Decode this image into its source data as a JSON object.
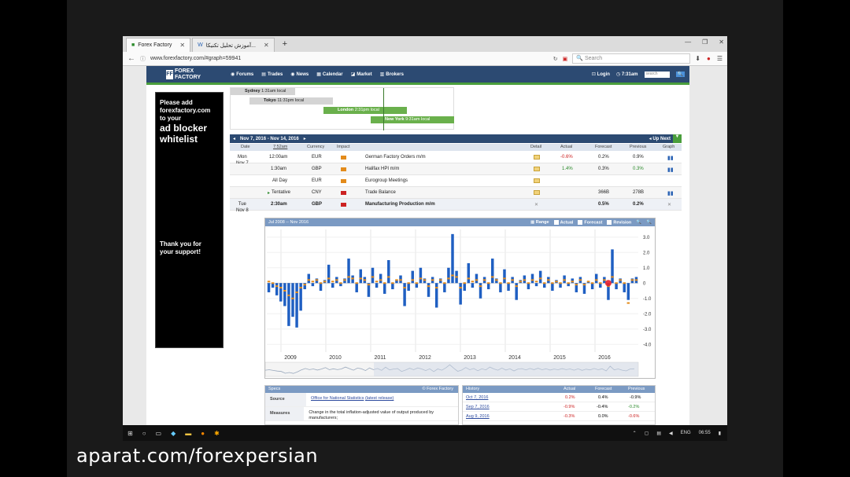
{
  "browser": {
    "tabs": [
      {
        "label": "Forex Factory",
        "active": true
      },
      {
        "label": "آموزش تحلیل تکنیکا...",
        "active": false
      }
    ],
    "url": "www.forexfactory.com/#graph=59941",
    "search_placeholder": "Search"
  },
  "site": {
    "logo_line1": "FOREX",
    "logo_line2": "FACTORY",
    "menu": [
      "Forums",
      "Trades",
      "News",
      "Calendar",
      "Market",
      "Brokers"
    ],
    "login": "Login",
    "time": "7:31am",
    "search_placeholder": "search"
  },
  "ad": {
    "line1": "Please add",
    "line2": "forexfactory.com",
    "line3": "to your",
    "big1": "ad blocker",
    "big2": "whitelist",
    "thanks1": "Thank you for",
    "thanks2": "your support!"
  },
  "sessions": [
    {
      "city": "Sydney",
      "time": "1:31am local"
    },
    {
      "city": "Tokyo",
      "time": "11:31pm local"
    },
    {
      "city": "London",
      "time": "2:31pm local"
    },
    {
      "city": "New York",
      "time": "9:31am local"
    }
  ],
  "calendar": {
    "range": "Nov 7, 2016 - Nov 14, 2016",
    "up_next": "Up Next",
    "columns": {
      "date": "Date",
      "time": "7:52am",
      "currency": "Currency",
      "impact": "Impact",
      "detail": "Detail",
      "actual": "Actual",
      "forecast": "Forecast",
      "previous": "Previous",
      "graph": "Graph"
    },
    "day1": {
      "dow": "Mon",
      "date": "Nov 7"
    },
    "day2": {
      "dow": "Tue",
      "date": "Nov 8"
    },
    "events": [
      {
        "time": "12:00am",
        "currency": "EUR",
        "event": "German Factory Orders m/m",
        "actual": "-0.6%",
        "forecast": "0.2%",
        "previous": "0.9%"
      },
      {
        "time": "1:30am",
        "currency": "GBP",
        "event": "Halifax HPI m/m",
        "actual": "1.4%",
        "forecast": "0.3%",
        "previous": "0.3%"
      },
      {
        "time": "All Day",
        "currency": "EUR",
        "event": "Eurogroup Meetings",
        "actual": "",
        "forecast": "",
        "previous": ""
      },
      {
        "time": "Tentative",
        "currency": "CNY",
        "event": "Trade Balance",
        "actual": "",
        "forecast": "366B",
        "previous": "278B"
      },
      {
        "time": "2:30am",
        "currency": "GBP",
        "event": "Manufacturing Production m/m",
        "actual": "",
        "forecast": "0.5%",
        "previous": "0.2%"
      }
    ]
  },
  "graph": {
    "range_label": "Jul 2008 -- Nov 2016",
    "range_btn": "Range",
    "actual": "Actual",
    "forecast": "Forecast",
    "revision": "Revision"
  },
  "chart_data": {
    "type": "bar",
    "ylim": [
      -4.5,
      3.5
    ],
    "yticks": [
      "3.0",
      "2.0",
      "1.0",
      "0",
      "-1.0",
      "-2.0",
      "-3.0",
      "-4.0"
    ],
    "xticks": [
      "2009",
      "2010",
      "2011",
      "2012",
      "2013",
      "2014",
      "2015",
      "2016"
    ],
    "series": [
      {
        "name": "Actual",
        "values": [
          -0.6,
          -0.3,
          -0.8,
          -1.2,
          -1.5,
          -2.8,
          -2.2,
          -2.9,
          -1.8,
          -0.4,
          0.6,
          -0.2,
          0.3,
          -0.5,
          0.2,
          1.2,
          -0.3,
          0.4,
          -0.2,
          0.3,
          1.6,
          0.5,
          -0.6,
          0.9,
          0.4,
          -0.9,
          1.0,
          -0.3,
          0.6,
          -0.7,
          1.5,
          -0.4,
          0.2,
          0.5,
          -1.5,
          -0.5,
          0.8,
          -0.3,
          1.0,
          0.3,
          -0.9,
          0.4,
          -1.6,
          0.3,
          -0.6,
          1.0,
          3.2,
          0.8,
          -1.4,
          -0.5,
          1.3,
          -0.3,
          0.6,
          -1.0,
          0.4,
          -0.4,
          1.6,
          0.3,
          -0.6,
          0.9,
          -0.5,
          0.4,
          -1.1,
          0.2,
          0.5,
          -0.4,
          0.6,
          -0.2,
          0.8,
          -0.3,
          0.4,
          -0.5,
          0.2,
          -0.3,
          0.5,
          -0.2,
          0.3,
          -0.6,
          0.4,
          -0.7,
          0.1,
          -0.4,
          0.6,
          -0.3,
          0.4,
          -1.1,
          2.2,
          -0.4,
          0.3,
          -0.6,
          -1.1,
          0.3,
          0.4
        ]
      },
      {
        "name": "Forecast",
        "values": [
          0.1,
          0.0,
          -0.2,
          -0.3,
          -0.5,
          -0.8,
          -1.0,
          -0.6,
          -0.3,
          -0.1,
          0.2,
          0.1,
          0.2,
          0.0,
          0.1,
          0.3,
          0.1,
          0.2,
          0.0,
          0.2,
          0.4,
          0.3,
          0.0,
          0.3,
          0.2,
          -0.1,
          0.4,
          0.1,
          0.2,
          0.0,
          0.4,
          0.0,
          0.2,
          0.2,
          -0.3,
          0.0,
          0.2,
          0.0,
          0.3,
          0.2,
          -0.2,
          0.2,
          -0.3,
          0.2,
          0.0,
          0.3,
          0.5,
          0.4,
          -0.3,
          0.0,
          0.3,
          0.1,
          0.2,
          -0.2,
          0.2,
          0.0,
          0.4,
          0.2,
          0.0,
          0.3,
          0.0,
          0.2,
          -0.2,
          0.1,
          0.2,
          0.0,
          0.2,
          0.1,
          0.3,
          0.0,
          0.2,
          0.0,
          0.1,
          0.0,
          0.2,
          0.0,
          0.1,
          -0.1,
          0.2,
          -0.1,
          0.1,
          0.0,
          0.2,
          0.0,
          0.2,
          -0.2,
          0.4,
          0.0,
          0.2,
          0.0,
          -1.3,
          0.2,
          0.2
        ]
      }
    ]
  },
  "specs": {
    "title": "Specs",
    "source_label": "© Forex Factory",
    "source_key": "Source",
    "source_val": "Office for National Statistics",
    "source_link": "(latest release)",
    "measures_key": "Measures",
    "measures_val": "Change in the total inflation-adjusted value of output produced by manufacturers;"
  },
  "history": {
    "title": "History",
    "cols": [
      "Actual",
      "Forecast",
      "Previous"
    ],
    "rows": [
      {
        "date": "Oct 7, 2016",
        "actual": "0.2%",
        "forecast": "0.4%",
        "previous": "-0.9%"
      },
      {
        "date": "Sep 7, 2016",
        "actual": "-0.9%",
        "forecast": "-0.4%",
        "previous": "-0.2%"
      },
      {
        "date": "Aug 9, 2016",
        "actual": "-0.3%",
        "forecast": "0.0%",
        "previous": "-0.6%"
      }
    ]
  },
  "taskbar": {
    "lang": "ENG",
    "clock": "06:55"
  },
  "watermark": "aparat.com/forexpersian",
  "colors": {
    "header": "#2c4a72",
    "accent": "#4a9e3c",
    "bar": "#1f5fc2",
    "forecast": "#e38b1b"
  }
}
